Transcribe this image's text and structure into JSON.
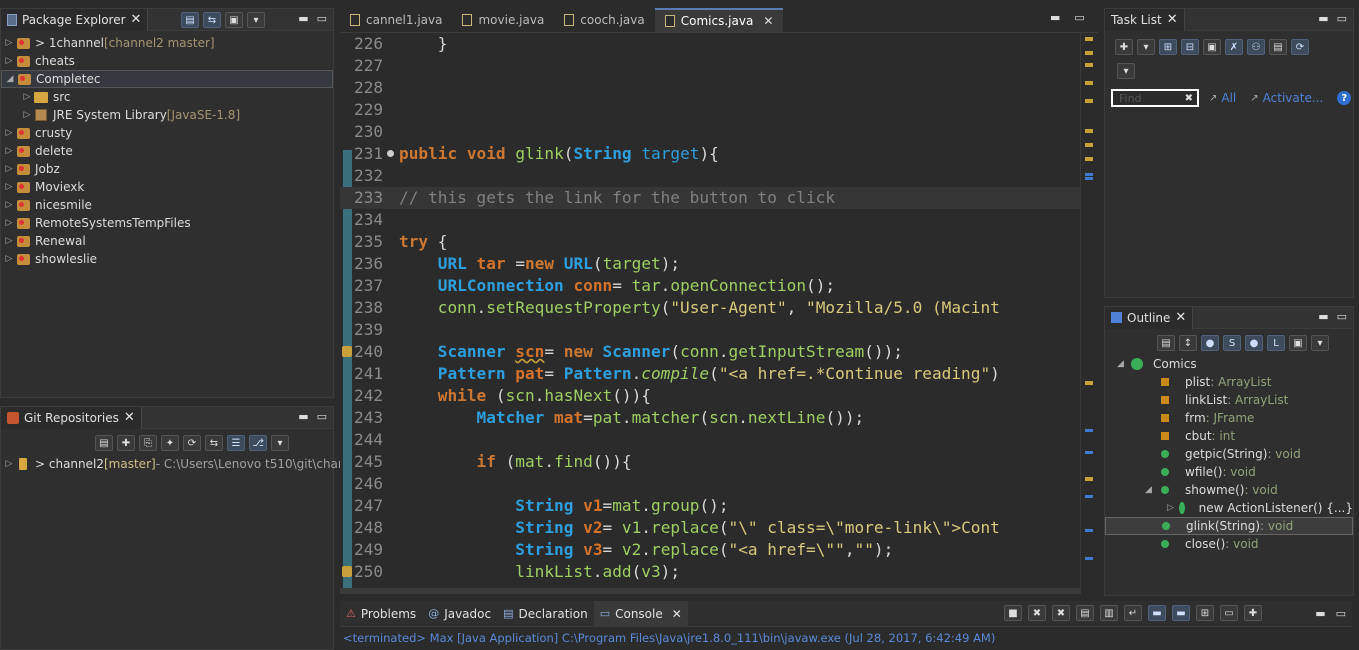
{
  "package_explorer": {
    "title": "Package Explorer",
    "items": [
      {
        "name": "> 1channel",
        "suffix": " [channel2 master]",
        "expanded": false
      },
      {
        "name": "cheats",
        "suffix": "",
        "expanded": false
      },
      {
        "name": "Completec",
        "suffix": "",
        "expanded": true,
        "selected": true
      },
      {
        "name": "src",
        "suffix": "",
        "child": true
      },
      {
        "name": "JRE System Library",
        "suffix": " [JavaSE-1.8]",
        "child": true
      },
      {
        "name": "crusty",
        "suffix": "",
        "expanded": false
      },
      {
        "name": "delete",
        "suffix": "",
        "expanded": false
      },
      {
        "name": "Jobz",
        "suffix": "",
        "expanded": false
      },
      {
        "name": "Moviexk",
        "suffix": "",
        "expanded": false
      },
      {
        "name": "nicesmile",
        "suffix": "",
        "expanded": false
      },
      {
        "name": "RemoteSystemsTempFiles",
        "suffix": "",
        "expanded": false
      },
      {
        "name": "Renewal",
        "suffix": "",
        "expanded": false
      },
      {
        "name": "showleslie",
        "suffix": "",
        "expanded": false
      }
    ]
  },
  "git_repositories": {
    "title": "Git Repositories",
    "repo_name": "> channel2",
    "repo_branch": " [master]",
    "repo_path": " - C:\\Users\\Lenovo t510\\git\\channe"
  },
  "editor": {
    "tabs": [
      "cannel1.java",
      "movie.java",
      "cooch.java",
      "Comics.java"
    ],
    "active_tab": "Comics.java"
  },
  "code_lines": [
    {
      "n": "226",
      "text": "    }"
    },
    {
      "n": "227",
      "text": ""
    },
    {
      "n": "228",
      "text": ""
    },
    {
      "n": "229",
      "text": ""
    },
    {
      "n": "230",
      "text": ""
    },
    {
      "n": "231",
      "text": "public void glink(String target){"
    },
    {
      "n": "232",
      "text": ""
    },
    {
      "n": "233",
      "text": "// this gets the link for the button to click"
    },
    {
      "n": "234",
      "text": ""
    },
    {
      "n": "235",
      "text": "try {"
    },
    {
      "n": "236",
      "text": "    URL tar =new URL(target);"
    },
    {
      "n": "237",
      "text": "    URLConnection conn= tar.openConnection();"
    },
    {
      "n": "238",
      "text": "    conn.setRequestProperty(\"User-Agent\", \"Mozilla/5.0 (Macint"
    },
    {
      "n": "239",
      "text": ""
    },
    {
      "n": "240",
      "text": "    Scanner scn= new Scanner(conn.getInputStream());"
    },
    {
      "n": "241",
      "text": "    Pattern pat= Pattern.compile(\"<a href=.*Continue reading\")"
    },
    {
      "n": "242",
      "text": "    while (scn.hasNext()){"
    },
    {
      "n": "243",
      "text": "        Matcher mat=pat.matcher(scn.nextLine());"
    },
    {
      "n": "244",
      "text": ""
    },
    {
      "n": "245",
      "text": "        if (mat.find()){"
    },
    {
      "n": "246",
      "text": ""
    },
    {
      "n": "247",
      "text": "            String v1=mat.group();"
    },
    {
      "n": "248",
      "text": "            String v2= v1.replace(\"\\\" class=\\\"more-link\\\">Cont"
    },
    {
      "n": "249",
      "text": "            String v3= v2.replace(\"<a href=\\\"\",\"\");"
    },
    {
      "n": "250",
      "text": "            linkList.add(v3);"
    }
  ],
  "task_list": {
    "title": "Task List",
    "find_placeholder": "Find",
    "all_label": "All",
    "activate_label": "Activate..."
  },
  "outline": {
    "title": "Outline",
    "class_name": "Comics",
    "members": [
      {
        "name": "plist",
        "type": " : ArrayList",
        "icon": "field-icon"
      },
      {
        "name": "linkList",
        "type": " : ArrayList",
        "icon": "field-icon"
      },
      {
        "name": "frm",
        "type": " : JFrame",
        "icon": "field-icon"
      },
      {
        "name": "cbut",
        "type": " : int",
        "icon": "field-icon"
      },
      {
        "name": "getpic(String)",
        "type": " : void",
        "icon": "method-icon"
      },
      {
        "name": "wfile()",
        "type": " : void",
        "icon": "method-icon"
      },
      {
        "name": "showme()",
        "type": " : void",
        "icon": "method-icon"
      },
      {
        "name": "new ActionListener() {...}",
        "type": "",
        "icon": "anon-class-icon"
      },
      {
        "name": "glink(String)",
        "type": " : void",
        "icon": "method-icon"
      },
      {
        "name": "close()",
        "type": " : void",
        "icon": "method-icon"
      }
    ]
  },
  "console": {
    "tabs": [
      "Problems",
      "Javadoc",
      "Declaration",
      "Console"
    ],
    "active_tab": "Console",
    "output": "<terminated> Max [Java Application] C:\\Program Files\\Java\\jre1.8.0_111\\bin\\javaw.exe (Jul 28, 2017, 6:42:49 AM)"
  },
  "colors": {
    "background": "#2b2b2b",
    "keyword": "#cc7832",
    "type": "#2e9fde",
    "method": "#9fcf63",
    "variable": "#d4722a",
    "comment": "#808080",
    "link": "#4f82d6"
  }
}
